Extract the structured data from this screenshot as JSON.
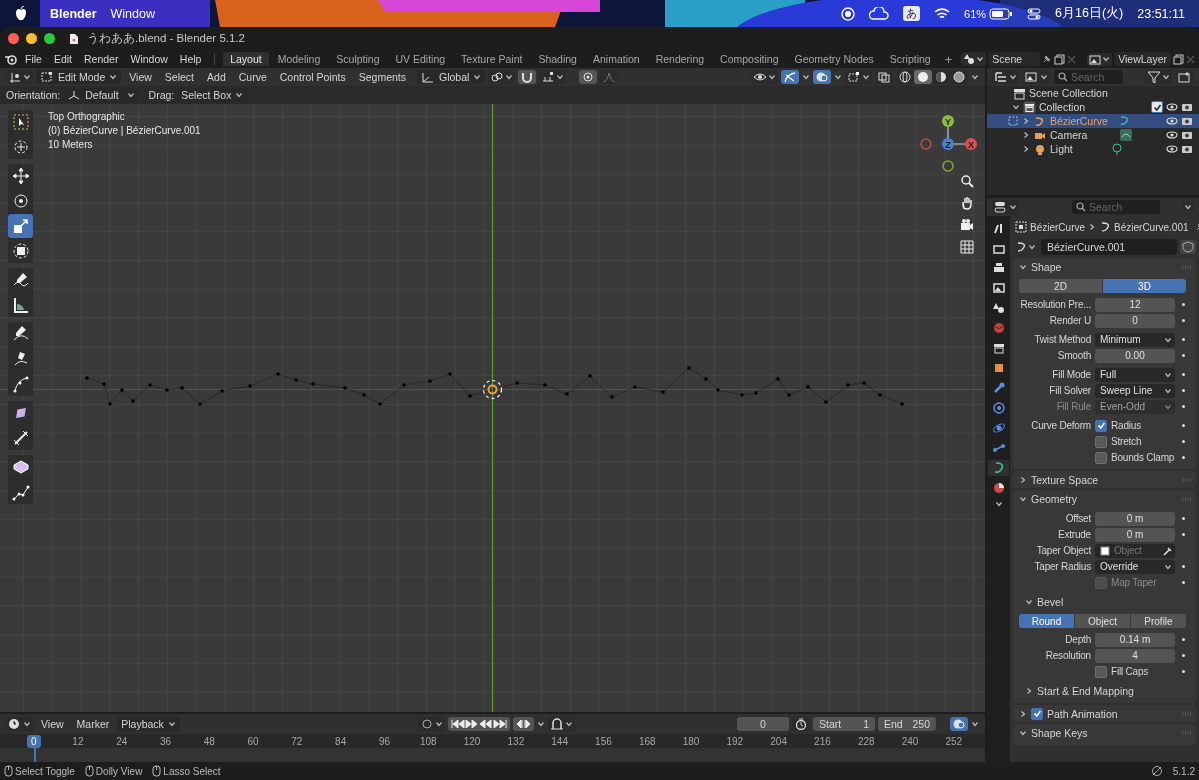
{
  "menubar": {
    "app": "Blender",
    "items": [
      "Window"
    ],
    "input_method": "あ",
    "battery": "61%",
    "date": "6月16日(火)",
    "time": "23:51:11"
  },
  "window": {
    "title": "うわああ.blend - Blender 5.1.2"
  },
  "topbar": {
    "menus": [
      "File",
      "Edit",
      "Render",
      "Window",
      "Help"
    ],
    "workspaces": [
      {
        "label": "Layout",
        "selected": true
      },
      {
        "label": "Modeling",
        "selected": false
      },
      {
        "label": "Sculpting",
        "selected": false
      },
      {
        "label": "UV Editing",
        "selected": false
      },
      {
        "label": "Texture Paint",
        "selected": false
      },
      {
        "label": "Shading",
        "selected": false
      },
      {
        "label": "Animation",
        "selected": false
      },
      {
        "label": "Rendering",
        "selected": false
      },
      {
        "label": "Compositing",
        "selected": false
      },
      {
        "label": "Geometry Nodes",
        "selected": false
      },
      {
        "label": "Scripting",
        "selected": false
      }
    ],
    "add_workspace": "+",
    "scene": "Scene",
    "view_layer": "ViewLayer"
  },
  "viewport_header": {
    "mode": "Edit Mode",
    "menus": [
      "View",
      "Select",
      "Add",
      "Curve",
      "Control Points",
      "Segments"
    ],
    "orientation": "Global",
    "gizmos_on": true,
    "overlays_on": true,
    "shading": [
      {
        "kind": "wireframe",
        "selected": false
      },
      {
        "kind": "solid",
        "selected": true
      },
      {
        "kind": "material",
        "selected": false
      },
      {
        "kind": "rendered",
        "selected": false
      }
    ]
  },
  "tool_settings": {
    "orientation_label": "Orientation:",
    "orientation": "Default",
    "drag_label": "Drag:",
    "drag": "Select Box"
  },
  "viewport": {
    "overlay_lines": [
      "Top Orthographic",
      "(0) BézierCurve | BézierCurve.001",
      "10 Meters"
    ],
    "tool_groups": [
      [
        {
          "kind": "select",
          "selected": false
        },
        {
          "kind": "cursor",
          "selected": false
        }
      ],
      [
        {
          "kind": "move",
          "selected": false
        },
        {
          "kind": "rotate",
          "selected": false
        },
        {
          "kind": "scale",
          "selected": true
        },
        {
          "kind": "transform",
          "selected": false
        }
      ],
      [
        {
          "kind": "annotate",
          "selected": false
        },
        {
          "kind": "measure",
          "selected": false
        }
      ],
      [
        {
          "kind": "draw",
          "selected": false
        },
        {
          "kind": "pen",
          "selected": false
        },
        {
          "kind": "extrude",
          "selected": false
        }
      ],
      [
        {
          "kind": "radius",
          "selected": false
        },
        {
          "kind": "tilt",
          "selected": false
        }
      ],
      [
        {
          "kind": "prism",
          "selected": false
        },
        {
          "kind": "polyline",
          "selected": false
        }
      ]
    ],
    "gizmo_axes": [
      "Y",
      "Z",
      "X"
    ]
  },
  "timeline": {
    "menus": [
      "View",
      "Marker"
    ],
    "playback": "Playback",
    "current_frame": "0",
    "start_label": "Start",
    "start": "1",
    "end_label": "End",
    "end": "250",
    "playhead": "0",
    "ruler": [
      "12",
      "24",
      "36",
      "48",
      "60",
      "72",
      "84",
      "96",
      "108",
      "120",
      "132",
      "144",
      "156",
      "168",
      "180",
      "192",
      "204",
      "216",
      "228",
      "240",
      "252"
    ]
  },
  "outliner": {
    "search_placeholder": "Search",
    "tree": [
      {
        "label": "Scene Collection",
        "kind": "scene",
        "children": [
          {
            "label": "Collection",
            "kind": "collection",
            "checked": true,
            "children": [
              {
                "label": "BézierCurve",
                "kind": "curve",
                "selected": true
              },
              {
                "label": "Camera",
                "kind": "camera",
                "selected": false
              },
              {
                "label": "Light",
                "kind": "light",
                "selected": false
              }
            ]
          }
        ]
      }
    ]
  },
  "properties": {
    "search_placeholder": "Search",
    "tabs": [
      {
        "kind": "tool",
        "selected": false
      },
      {
        "kind": "render",
        "selected": false
      },
      {
        "kind": "output",
        "selected": false
      },
      {
        "kind": "view_layer",
        "selected": false
      },
      {
        "kind": "scene",
        "selected": false
      },
      {
        "kind": "world",
        "selected": false
      },
      {
        "kind": "collection",
        "selected": false
      },
      {
        "kind": "object",
        "selected": false
      },
      {
        "kind": "modifier",
        "selected": false
      },
      {
        "kind": "particles",
        "selected": false
      },
      {
        "kind": "physics",
        "selected": false
      },
      {
        "kind": "constraints",
        "selected": false
      },
      {
        "kind": "data",
        "selected": true
      },
      {
        "kind": "material",
        "selected": false
      }
    ],
    "breadcrumb": [
      "BézierCurve",
      "BézierCurve.001"
    ],
    "datablock": "BézierCurve.001",
    "panels": [
      {
        "title": "Shape",
        "expanded": true,
        "groups": [
          [
            {
              "kind": "segmented",
              "options": [
                {
                  "label": "2D",
                  "selected": false
                },
                {
                  "label": "3D",
                  "selected": true
                }
              ]
            }
          ],
          [
            {
              "kind": "number",
              "label": "Resolution Pre...",
              "value": "12",
              "disabled": false
            },
            {
              "kind": "number",
              "label": "Render U",
              "value": "0",
              "disabled": false
            }
          ],
          [
            {
              "kind": "dropdown",
              "label": "Twist Method",
              "value": "Minimum",
              "disabled": false
            },
            {
              "kind": "number",
              "label": "Smooth",
              "value": "0.00",
              "disabled": false
            }
          ],
          [
            {
              "kind": "dropdown",
              "label": "Fill Mode",
              "value": "Full",
              "disabled": false
            },
            {
              "kind": "dropdown",
              "label": "Fill Solver",
              "value": "Sweep Line",
              "disabled": false
            },
            {
              "kind": "dropdown",
              "label": "Fill Rule",
              "value": "Even-Odd",
              "disabled": true
            }
          ],
          [
            {
              "kind": "checkbox",
              "label": "Curve Deform",
              "text": "Radius",
              "checked": true,
              "disabled": false
            },
            {
              "kind": "checkbox",
              "text": "Stretch",
              "checked": false,
              "disabled": false
            },
            {
              "kind": "checkbox",
              "text": "Bounds Clamp",
              "checked": false,
              "disabled": false
            }
          ]
        ]
      },
      {
        "title": "Texture Space",
        "expanded": false
      },
      {
        "title": "Geometry",
        "expanded": true,
        "groups": [
          [
            {
              "kind": "number",
              "label": "Offset",
              "value": "0 m",
              "disabled": false
            },
            {
              "kind": "number",
              "label": "Extrude",
              "value": "0 m",
              "disabled": false
            },
            {
              "kind": "object",
              "label": "Taper Object",
              "placeholder": "Object",
              "disabled": false
            },
            {
              "kind": "dropdown",
              "label": "Taper Radius",
              "value": "Override",
              "disabled": false
            },
            {
              "kind": "checkbox",
              "text": "Map Taper",
              "checked": false,
              "disabled": true
            }
          ],
          [
            {
              "kind": "subpanel",
              "title": "Bevel",
              "expanded": true,
              "groups": [
                [
                  {
                    "kind": "segmented",
                    "options": [
                      {
                        "label": "Round",
                        "selected": true
                      },
                      {
                        "label": "Object",
                        "selected": false
                      },
                      {
                        "label": "Profile",
                        "selected": false
                      }
                    ]
                  }
                ],
                [
                  {
                    "kind": "number",
                    "label": "Depth",
                    "value": "0.14 m",
                    "disabled": false
                  },
                  {
                    "kind": "number",
                    "label": "Resolution",
                    "value": "4",
                    "disabled": false
                  },
                  {
                    "kind": "checkbox",
                    "text": "Fill Caps",
                    "checked": false,
                    "disabled": false
                  }
                ]
              ]
            }
          ],
          [
            {
              "kind": "subpanel",
              "title": "Start & End Mapping",
              "expanded": false
            }
          ]
        ]
      },
      {
        "title": "Path Animation",
        "expanded": false,
        "checked": true
      },
      {
        "title": "Shape Keys",
        "expanded": true
      }
    ]
  },
  "status_bar": {
    "hints": [
      "Select Toggle",
      "Dolly View",
      "Lasso Select"
    ],
    "version": "5.1.2"
  }
}
